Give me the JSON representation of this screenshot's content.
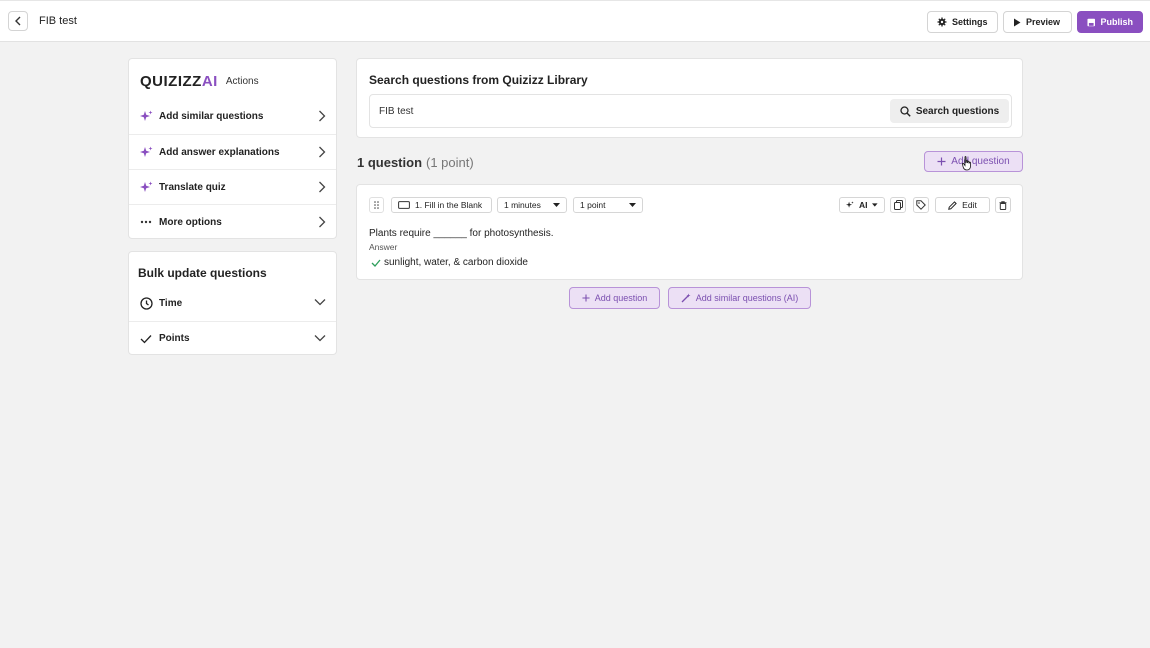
{
  "header": {
    "title": "FIB test",
    "settings_label": "Settings",
    "preview_label": "Preview",
    "publish_label": "Publish"
  },
  "actions_panel": {
    "brand": "QUIZIZZ",
    "brand_ai": "AI",
    "heading": "Actions",
    "items": [
      {
        "label": "Add similar questions",
        "icon": "sparkle-icon"
      },
      {
        "label": "Add answer explanations",
        "icon": "sparkle-icon"
      },
      {
        "label": "Translate quiz",
        "icon": "sparkle-icon"
      },
      {
        "label": "More options",
        "icon": "dots-icon"
      }
    ]
  },
  "bulk_panel": {
    "title": "Bulk update questions",
    "items": [
      {
        "label": "Time",
        "icon": "clock-icon"
      },
      {
        "label": "Points",
        "icon": "check-icon"
      }
    ]
  },
  "search": {
    "title": "Search questions from Quizizz Library",
    "value": "FIB test",
    "button_label": "Search questions"
  },
  "summary": {
    "count_label": "1 question",
    "points_label": "(1 point)",
    "add_question_label": "Add question"
  },
  "question": {
    "type_label": "1. Fill in the Blank",
    "time_label": "1 minutes",
    "points_label": "1 point",
    "ai_label": "AI",
    "edit_label": "Edit",
    "text": "Plants require ______ for photosynthesis.",
    "answer_label": "Answer",
    "answer": "sunlight, water, & carbon dioxide"
  },
  "bottom": {
    "add_question_label": "Add question",
    "add_similar_label": "Add similar questions (AI)"
  },
  "colors": {
    "accent": "#8a4fc0",
    "accent_light": "#ece0f5",
    "correct": "#2e9e5b"
  }
}
